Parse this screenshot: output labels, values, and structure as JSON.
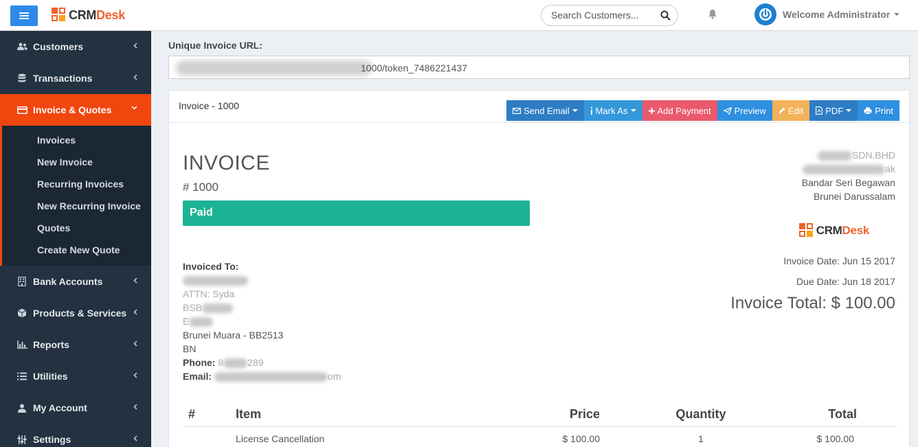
{
  "header": {
    "logo_crm": "CRM",
    "logo_desk": "Desk",
    "search_placeholder": "Search Customers...",
    "welcome": "Welcome Administrator"
  },
  "sidebar": {
    "items": [
      {
        "label": "Customers",
        "icon": "users-icon"
      },
      {
        "label": "Transactions",
        "icon": "database-icon"
      },
      {
        "label": "Invoice & Quotes",
        "icon": "credit-card-icon",
        "active": true
      },
      {
        "label": "Bank Accounts",
        "icon": "building-icon"
      },
      {
        "label": "Products & Services",
        "icon": "cube-icon"
      },
      {
        "label": "Reports",
        "icon": "bar-chart-icon"
      },
      {
        "label": "Utilities",
        "icon": "list-icon"
      },
      {
        "label": "My Account",
        "icon": "user-icon"
      },
      {
        "label": "Settings",
        "icon": "sliders-icon"
      }
    ],
    "submenu": [
      "Invoices",
      "New Invoice",
      "Recurring Invoices",
      "New Recurring Invoice",
      "Quotes",
      "Create New Quote"
    ]
  },
  "main": {
    "url_label": "Unique Invoice URL:",
    "url_value": "1000/token_7486221437",
    "panel_title": "Invoice - 1000",
    "buttons": [
      {
        "label": "Send Email",
        "icon": "envelope-icon",
        "color": "#2e7dc4"
      },
      {
        "label": "Mark As",
        "icon": "info-icon",
        "color": "#3498db"
      },
      {
        "label": "Add Payment",
        "icon": "plus-icon",
        "color": "#ea5a6c"
      },
      {
        "label": "Preview",
        "icon": "paper-plane-icon",
        "color": "#2f8fe0"
      },
      {
        "label": "Edit",
        "icon": "pencil-icon",
        "color": "#f4b25a"
      },
      {
        "label": "PDF",
        "icon": "file-pdf-icon",
        "color": "#2e7dc4"
      },
      {
        "label": "Print",
        "icon": "print-icon",
        "color": "#2f8fe0"
      }
    ],
    "invoice_heading": "INVOICE",
    "invoice_number": "# 1000",
    "status": "Paid",
    "company": {
      "line1_visible": "SDN.BHD",
      "line2_visible": "ak",
      "line3": "Bandar Seri Begawan",
      "line4": "Brunei Darussalam"
    },
    "invoiced_to_label": "Invoiced To:",
    "invoiced_to": {
      "attn": "ATTN: Syda",
      "line_bsb": "BSB",
      "line_e": "E",
      "city": "Brunei Muara - BB2513",
      "country": "BN",
      "phone_label": "Phone:",
      "phone_visible": "8",
      "phone_tail": "289",
      "email_label": "Email:",
      "email_tail": "om"
    },
    "invoice_date": "Invoice Date: Jun 15 2017",
    "due_date": "Due Date: Jun 18 2017",
    "invoice_total": "Invoice Total: $ 100.00",
    "table": {
      "headers": [
        "#",
        "Item",
        "Price",
        "Quantity",
        "Total"
      ],
      "rows": [
        {
          "num": "",
          "item": "License Cancellation",
          "price": "$ 100.00",
          "qty": "1",
          "total": "$ 100.00"
        }
      ]
    }
  }
}
